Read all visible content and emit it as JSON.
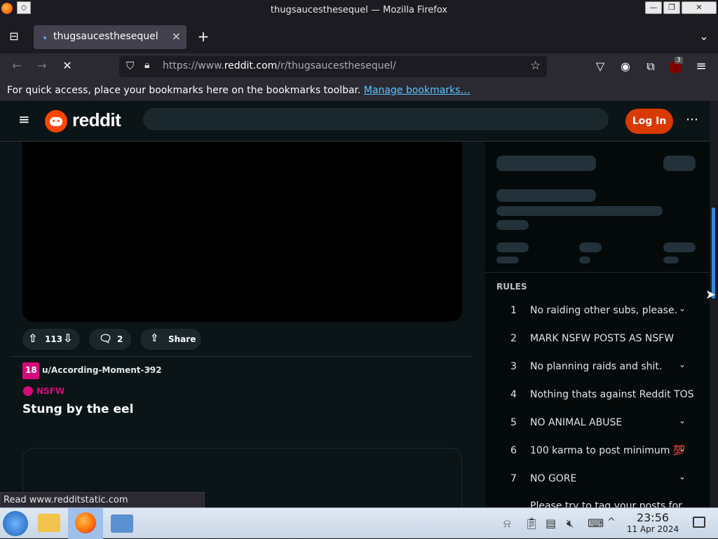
{
  "window": {
    "title": "thugsaucesthesequel — Mozilla Firefox"
  },
  "browser": {
    "tab_title": "thugsaucesthesequel",
    "url_prefix": "https://www.",
    "url_domain": "reddit.com",
    "url_path": "/r/thugsaucesthesequel/",
    "extension_badge": "3",
    "bookmark_message": "For quick access, place your bookmarks here on the bookmarks toolbar.",
    "bookmark_link": "Manage bookmarks…",
    "status_text": "Read www.redditstatic.com"
  },
  "reddit": {
    "logo_text": "reddit",
    "login_label": "Log In",
    "post1": {
      "score": "113",
      "comments": "2",
      "share_label": "Share"
    },
    "post2": {
      "author": "u/According-Moment-392",
      "avatar_badge": "18",
      "nsfw_label": "NSFW",
      "title": "Stung by the eel"
    },
    "rules_header": "RULES",
    "rules": [
      {
        "num": "1",
        "text": "No raiding other subs, please.",
        "expandable": true
      },
      {
        "num": "2",
        "text": "MARK NSFW POSTS AS NSFW",
        "expandable": false
      },
      {
        "num": "3",
        "text": "No planning raids and shit.",
        "expandable": true
      },
      {
        "num": "4",
        "text": "Nothing thats against Reddit TOS",
        "expandable": false
      },
      {
        "num": "5",
        "text": "NO ANIMAL ABUSE",
        "expandable": true
      },
      {
        "num": "6",
        "text": "100 karma to post minimum 💯",
        "expandable": true
      },
      {
        "num": "7",
        "text": "NO GORE",
        "expandable": true
      }
    ],
    "rule8_partial": "Please try to tag your posts for"
  },
  "taskbar": {
    "time": "23:56",
    "date": "11 Apr 2024"
  },
  "colors": {
    "reddit_orange": "#d93a00",
    "page_bg": "#0b1416",
    "link_blue": "#57c7ff",
    "nsfw_pink": "#d50a7a"
  }
}
